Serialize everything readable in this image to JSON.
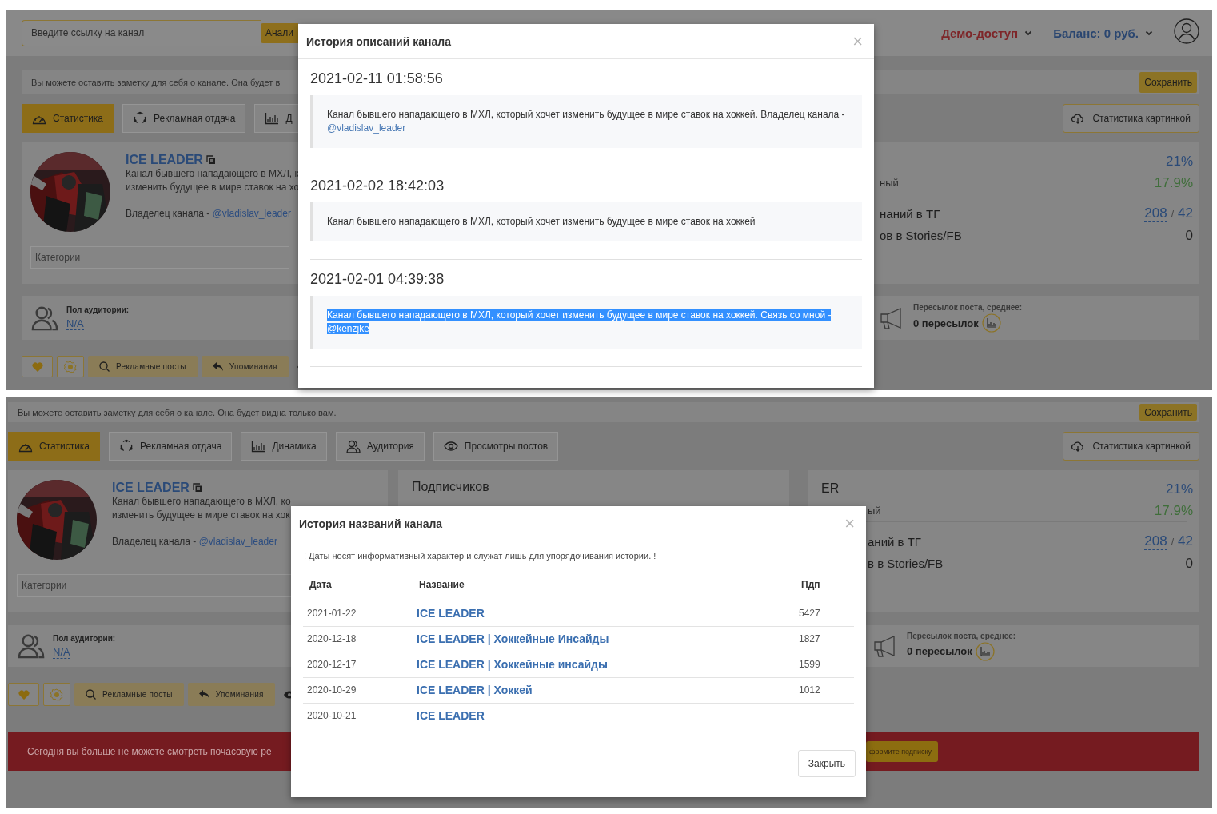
{
  "screens": [
    {
      "top_bar": {
        "search_field": {
          "placeholder": "Введите ссылку на канал"
        },
        "analyze_button": "Анали",
        "demo_access": "Демо-доступ",
        "balance": "Баланс: 0 руб."
      },
      "note_field": {
        "placeholder": "Вы можете оставить заметку для себя о канале. Она будет в"
      },
      "save_button": "Сохранить",
      "tabs": [
        {
          "label": "Статистика",
          "selected": true
        },
        {
          "label": "Рекламная отдача",
          "selected": false
        },
        {
          "label": "Д",
          "selected": false
        }
      ],
      "image_stats_button": "Статистика картинкой",
      "channel_card": {
        "name": "ICE LEADER",
        "description_lines": [
          "Канал бывшего нападающего в МХЛ, к",
          "изменить будущее в мире ставок на хо"
        ],
        "owner_label": "Владелец канала -",
        "owner_link": "@vladislav_leader",
        "categories_field": {
          "placeholder": "Категории"
        }
      },
      "er_card": {
        "rate_value": "21%",
        "reach_label": "ный",
        "reach_value": "17.9%",
        "mentions_label": "наний в ТГ",
        "mentions_value": "208",
        "mentions_separator": "/",
        "mentions_total": "42",
        "stories_label": "ов в Stories/FB",
        "stories_value": "0"
      },
      "audience_card": {
        "label": "Пол аудитории:",
        "value": "N/A"
      },
      "forwards_card": {
        "label": "Пересылок поста, среднее:",
        "value": "0 пересылок"
      },
      "action_buttons": [
        "Рекламные посты",
        "Упоминания"
      ],
      "modal": {
        "kind": "description_history",
        "title": "История описаний канала",
        "close_button": "×",
        "entries": [
          {
            "date": "2021-02-11 01:58:56",
            "text": "Канал бывшего нападающего в МХЛ, который хочет изменить будущее в мире ставок на хоккей. Владелец канала -",
            "link": "@vladislav_leader",
            "highlighted": false
          },
          {
            "date": "2021-02-02 18:42:03",
            "text": "Канал бывшего нападающего в МХЛ, который хочет изменить будущее в мире ставок на хоккей",
            "highlighted": false
          },
          {
            "date": "2021-02-01 04:39:38",
            "text": "Канал бывшего нападающего в МХЛ, который хочет изменить будущее в мире ставок на хоккей. Связь со мной -",
            "link": "@kenzjke",
            "highlighted": true
          }
        ]
      }
    },
    {
      "note_field": {
        "placeholder": "Вы можете оставить заметку для себя о канале. Она будет видна только вам."
      },
      "save_button": "Сохранить",
      "tabs": [
        {
          "label": "Статистика",
          "selected": true
        },
        {
          "label": "Рекламная отдача",
          "selected": false
        },
        {
          "label": "Динамика",
          "selected": false
        },
        {
          "label": "Аудитория",
          "selected": false
        },
        {
          "label": "Просмотры постов",
          "selected": false
        }
      ],
      "image_stats_button": "Статистика картинкой",
      "channel_card": {
        "name": "ICE LEADER",
        "description_lines": [
          "Канал бывшего нападающего в МХЛ, ко",
          "изменить будущее в мире ставок на хок"
        ],
        "owner_label": "Владелец канала -",
        "owner_link": "@vladislav_leader",
        "categories_field": {
          "placeholder": "Категории"
        }
      },
      "subscribers_card": {
        "title": "Подписчиков"
      },
      "er_card": {
        "title": "ER",
        "rate_value": "21%",
        "reach_label": "ый",
        "reach_value": "17.9%",
        "mentions_label": "аний в ТГ",
        "mentions_value": "208",
        "mentions_separator": "/",
        "mentions_total": "42",
        "stories_label": "в в Stories/FB",
        "stories_value": "0"
      },
      "audience_card": {
        "label": "Пол аудитории:",
        "value": "N/A"
      },
      "forwards_card": {
        "label": "Пересылок поста, среднее:",
        "value": "0 пересылок"
      },
      "action_buttons": [
        "Рекламные посты",
        "Упоминания"
      ],
      "alert": {
        "text": "Сегодня вы больше не можете смотреть почасовую ре",
        "button": "формите подписку"
      },
      "modal": {
        "kind": "name_history",
        "title": "История названий канала",
        "close_button": "×",
        "note": "! Даты носят информативный характер и служат лишь для упорядочивания истории. !",
        "columns": [
          "Дата",
          "Название",
          "Пдп"
        ],
        "rows": [
          {
            "date": "2021-01-22",
            "name": "ICE LEADER",
            "subscribers": "5427"
          },
          {
            "date": "2020-12-18",
            "name": "ICE LEADER | Хоккейные Инсайды",
            "subscribers": "1827"
          },
          {
            "date": "2020-12-17",
            "name": "ICE LEADER | Хоккейные инсайды",
            "subscribers": "1599"
          },
          {
            "date": "2020-10-29",
            "name": "ICE LEADER | Хоккей",
            "subscribers": "1012"
          },
          {
            "date": "2020-10-21",
            "name": "ICE LEADER"
          }
        ],
        "close_footer_button": "Закрыть"
      }
    }
  ]
}
